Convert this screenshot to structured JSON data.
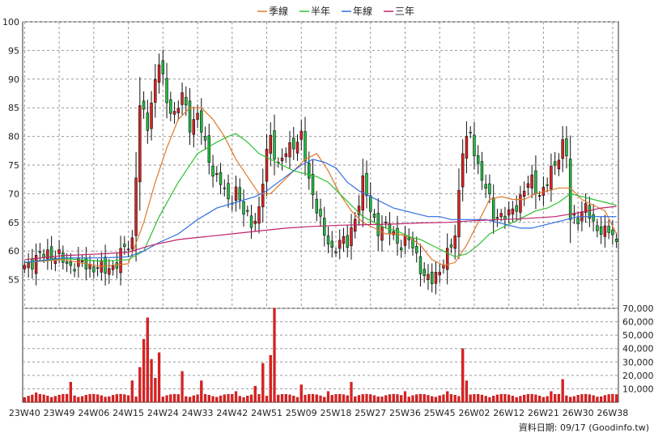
{
  "chart_data": {
    "type": "candlestick-volume",
    "legend": [
      {
        "name": "季線",
        "color": "#e0782a"
      },
      {
        "name": "半年",
        "color": "#2fc02f"
      },
      {
        "name": "年線",
        "color": "#2f6fe0"
      },
      {
        "name": "三年",
        "color": "#c0246a"
      }
    ],
    "price_axis": {
      "ylim": [
        50,
        100
      ],
      "ticks": [
        55,
        60,
        65,
        70,
        75,
        80,
        85,
        90,
        95,
        100
      ]
    },
    "volume_axis": {
      "ylim": [
        0,
        70000
      ],
      "ticks": [
        "10,000",
        "20,000",
        "30,000",
        "40,000",
        "50,000",
        "60,000",
        "70,000"
      ],
      "tick_values": [
        10000,
        20000,
        30000,
        40000,
        50000,
        60000,
        70000
      ]
    },
    "x_ticks": [
      "23W40",
      "23W49",
      "24W06",
      "24W15",
      "24W24",
      "24W33",
      "24W42",
      "24W51",
      "25W09",
      "25W18",
      "25W27",
      "25W36",
      "25W45",
      "26W02",
      "26W12",
      "26W21",
      "26W30",
      "26W38"
    ],
    "x_tick_positions": [
      0,
      9,
      18,
      27,
      36,
      45,
      54,
      63,
      72,
      81,
      90,
      99,
      108,
      117,
      126,
      135,
      144,
      153
    ],
    "week_count": 155,
    "close_anchors": [
      [
        0,
        57.5
      ],
      [
        3,
        58.5
      ],
      [
        6,
        59.8
      ],
      [
        9,
        58.8
      ],
      [
        12,
        57.5
      ],
      [
        15,
        57.8
      ],
      [
        18,
        57.2
      ],
      [
        21,
        56.8
      ],
      [
        24,
        57.8
      ],
      [
        26,
        60.5
      ],
      [
        28,
        62
      ],
      [
        30,
        85
      ],
      [
        32,
        82
      ],
      [
        34,
        90
      ],
      [
        35,
        93
      ],
      [
        37,
        86
      ],
      [
        39,
        84
      ],
      [
        41,
        87
      ],
      [
        43,
        82
      ],
      [
        45,
        84
      ],
      [
        47,
        78
      ],
      [
        49,
        74
      ],
      [
        51,
        72
      ],
      [
        53,
        68.5
      ],
      [
        55,
        71
      ],
      [
        57,
        66.5
      ],
      [
        59,
        65
      ],
      [
        61,
        67
      ],
      [
        63,
        77
      ],
      [
        64,
        80
      ],
      [
        66,
        75
      ],
      [
        68,
        77
      ],
      [
        70,
        79
      ],
      [
        72,
        80
      ],
      [
        74,
        72
      ],
      [
        76,
        68
      ],
      [
        78,
        62.5
      ],
      [
        80,
        60
      ],
      [
        82,
        62
      ],
      [
        84,
        61
      ],
      [
        86,
        66
      ],
      [
        88,
        72
      ],
      [
        90,
        67
      ],
      [
        92,
        64
      ],
      [
        94,
        64
      ],
      [
        96,
        63
      ],
      [
        98,
        61
      ],
      [
        100,
        62
      ],
      [
        102,
        59.5
      ],
      [
        104,
        55
      ],
      [
        106,
        55
      ],
      [
        108,
        57
      ],
      [
        110,
        59
      ],
      [
        112,
        63
      ],
      [
        114,
        78
      ],
      [
        116,
        80
      ],
      [
        118,
        75
      ],
      [
        120,
        71
      ],
      [
        122,
        66
      ],
      [
        124,
        66.5
      ],
      [
        126,
        66
      ],
      [
        128,
        68
      ],
      [
        130,
        71
      ],
      [
        132,
        72
      ],
      [
        134,
        70
      ],
      [
        136,
        72
      ],
      [
        138,
        75
      ],
      [
        140,
        79
      ],
      [
        141,
        77
      ],
      [
        142,
        65
      ],
      [
        144,
        66
      ],
      [
        146,
        68
      ],
      [
        148,
        64
      ],
      [
        150,
        64
      ],
      [
        152,
        63.5
      ],
      [
        154,
        61
      ]
    ],
    "ma_series": [
      {
        "name": "季線",
        "color": "#e0782a",
        "points": [
          [
            0,
            58
          ],
          [
            10,
            58.5
          ],
          [
            20,
            57.3
          ],
          [
            27,
            57.8
          ],
          [
            31,
            65
          ],
          [
            34,
            72
          ],
          [
            37,
            78
          ],
          [
            40,
            83
          ],
          [
            43,
            85
          ],
          [
            46,
            85
          ],
          [
            49,
            83
          ],
          [
            52,
            80
          ],
          [
            55,
            76
          ],
          [
            58,
            73
          ],
          [
            61,
            70
          ],
          [
            64,
            70
          ],
          [
            67,
            72
          ],
          [
            70,
            74
          ],
          [
            73,
            76
          ],
          [
            76,
            77
          ],
          [
            79,
            74
          ],
          [
            82,
            70
          ],
          [
            85,
            67
          ],
          [
            88,
            65
          ],
          [
            91,
            64
          ],
          [
            94,
            63
          ],
          [
            97,
            63
          ],
          [
            100,
            62.5
          ],
          [
            103,
            61
          ],
          [
            106,
            58.5
          ],
          [
            109,
            57.5
          ],
          [
            112,
            58
          ],
          [
            115,
            61
          ],
          [
            118,
            65
          ],
          [
            121,
            69
          ],
          [
            124,
            69.5
          ],
          [
            127,
            69
          ],
          [
            130,
            69
          ],
          [
            133,
            70
          ],
          [
            136,
            70.5
          ],
          [
            139,
            71
          ],
          [
            142,
            71
          ],
          [
            145,
            69
          ],
          [
            148,
            68
          ],
          [
            151,
            67
          ],
          [
            154,
            63
          ]
        ]
      },
      {
        "name": "半年",
        "color": "#2fc02f",
        "points": [
          [
            0,
            58
          ],
          [
            10,
            58.7
          ],
          [
            20,
            58.2
          ],
          [
            27,
            58.5
          ],
          [
            31,
            60
          ],
          [
            35,
            66
          ],
          [
            40,
            72
          ],
          [
            45,
            77
          ],
          [
            50,
            79
          ],
          [
            53,
            80
          ],
          [
            55,
            80.5
          ],
          [
            58,
            79
          ],
          [
            61,
            77
          ],
          [
            64,
            76
          ],
          [
            67,
            75
          ],
          [
            70,
            74
          ],
          [
            73,
            73.5
          ],
          [
            76,
            73
          ],
          [
            79,
            72
          ],
          [
            82,
            70
          ],
          [
            85,
            68
          ],
          [
            88,
            66
          ],
          [
            91,
            65
          ],
          [
            94,
            64
          ],
          [
            97,
            63.5
          ],
          [
            100,
            62.5
          ],
          [
            103,
            62
          ],
          [
            106,
            61
          ],
          [
            109,
            60
          ],
          [
            112,
            59
          ],
          [
            115,
            59.5
          ],
          [
            118,
            61
          ],
          [
            121,
            63
          ],
          [
            124,
            64
          ],
          [
            127,
            65
          ],
          [
            130,
            66
          ],
          [
            133,
            67
          ],
          [
            136,
            67.5
          ],
          [
            139,
            68.5
          ],
          [
            142,
            70
          ],
          [
            145,
            69.5
          ],
          [
            148,
            69
          ],
          [
            151,
            68.5
          ],
          [
            154,
            68
          ]
        ]
      },
      {
        "name": "年線",
        "color": "#2f6fe0",
        "points": [
          [
            0,
            58
          ],
          [
            10,
            58.8
          ],
          [
            20,
            58.8
          ],
          [
            27,
            59
          ],
          [
            31,
            60
          ],
          [
            35,
            61.5
          ],
          [
            40,
            63
          ],
          [
            45,
            65.5
          ],
          [
            50,
            67.5
          ],
          [
            55,
            68.5
          ],
          [
            60,
            69.5
          ],
          [
            63,
            70.5
          ],
          [
            66,
            72
          ],
          [
            69,
            73.5
          ],
          [
            72,
            75
          ],
          [
            75,
            76
          ],
          [
            78,
            75.5
          ],
          [
            81,
            74.5
          ],
          [
            84,
            72
          ],
          [
            87,
            70.5
          ],
          [
            90,
            69.5
          ],
          [
            93,
            68.5
          ],
          [
            96,
            67.5
          ],
          [
            99,
            67
          ],
          [
            102,
            66.5
          ],
          [
            105,
            66
          ],
          [
            108,
            66
          ],
          [
            111,
            65.5
          ],
          [
            114,
            65.5
          ],
          [
            117,
            65.5
          ],
          [
            120,
            65.5
          ],
          [
            123,
            65
          ],
          [
            126,
            64.5
          ],
          [
            129,
            64
          ],
          [
            132,
            64
          ],
          [
            135,
            64.5
          ],
          [
            138,
            65
          ],
          [
            141,
            65.5
          ],
          [
            144,
            66
          ],
          [
            147,
            66
          ],
          [
            150,
            66
          ],
          [
            154,
            66
          ]
        ]
      },
      {
        "name": "三年",
        "color": "#c0246a",
        "points": [
          [
            0,
            58.5
          ],
          [
            10,
            59.2
          ],
          [
            20,
            59.5
          ],
          [
            27,
            59.8
          ],
          [
            33,
            61
          ],
          [
            40,
            62
          ],
          [
            47,
            62.5
          ],
          [
            54,
            63
          ],
          [
            61,
            63.5
          ],
          [
            68,
            64
          ],
          [
            75,
            64.3
          ],
          [
            82,
            64.5
          ],
          [
            89,
            64.6
          ],
          [
            96,
            64.7
          ],
          [
            103,
            64.9
          ],
          [
            110,
            65
          ],
          [
            117,
            65.3
          ],
          [
            124,
            65.5
          ],
          [
            131,
            65.7
          ],
          [
            138,
            66
          ],
          [
            145,
            66.8
          ],
          [
            150,
            67.5
          ],
          [
            154,
            67.8
          ]
        ]
      }
    ],
    "volume_peaks": [
      [
        3,
        7000
      ],
      [
        12,
        15000
      ],
      [
        28,
        16000
      ],
      [
        30,
        26000
      ],
      [
        31,
        47000
      ],
      [
        32,
        63000
      ],
      [
        33,
        32000
      ],
      [
        34,
        18000
      ],
      [
        35,
        37000
      ],
      [
        41,
        23000
      ],
      [
        46,
        16000
      ],
      [
        55,
        8000
      ],
      [
        60,
        12000
      ],
      [
        62,
        29000
      ],
      [
        64,
        35000
      ],
      [
        65,
        73000
      ],
      [
        72,
        13000
      ],
      [
        79,
        8000
      ],
      [
        85,
        15000
      ],
      [
        99,
        8000
      ],
      [
        110,
        8000
      ],
      [
        114,
        40000
      ],
      [
        115,
        16000
      ],
      [
        137,
        8000
      ],
      [
        140,
        17000
      ]
    ],
    "volume_base": 3500
  },
  "credit": "資料日期: 09/17  (Goodinfo.tw)"
}
